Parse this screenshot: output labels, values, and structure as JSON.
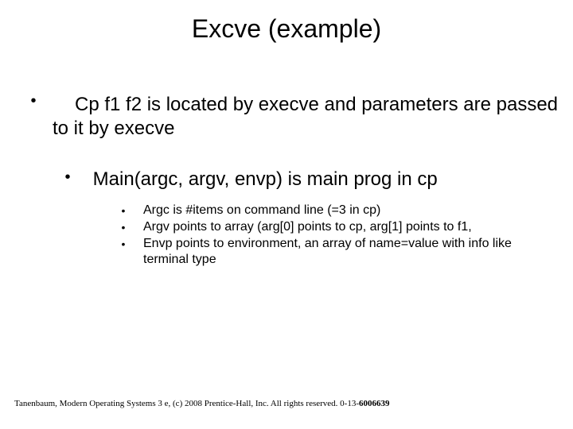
{
  "title": "Excve (example)",
  "bullet_lvl1": "Cp f1 f2 is located by execve and parameters are passed to it by execve",
  "bullet_lvl2": "Main(argc, argv, envp) is main prog in cp",
  "bullet_lvl3_a": "Argc is #items on command line (=3 in cp)",
  "bullet_lvl3_b": "Argv points to array (arg[0] points to cp, arg[1] points to f1,",
  "bullet_lvl3_c": "Envp points to environment, an array of name=value with info like terminal type",
  "footer_main": "Tanenbaum, Modern Operating Systems 3 e, (c) 2008 Prentice-Hall, Inc. All rights reserved. 0-13-",
  "footer_bold": "6006639"
}
